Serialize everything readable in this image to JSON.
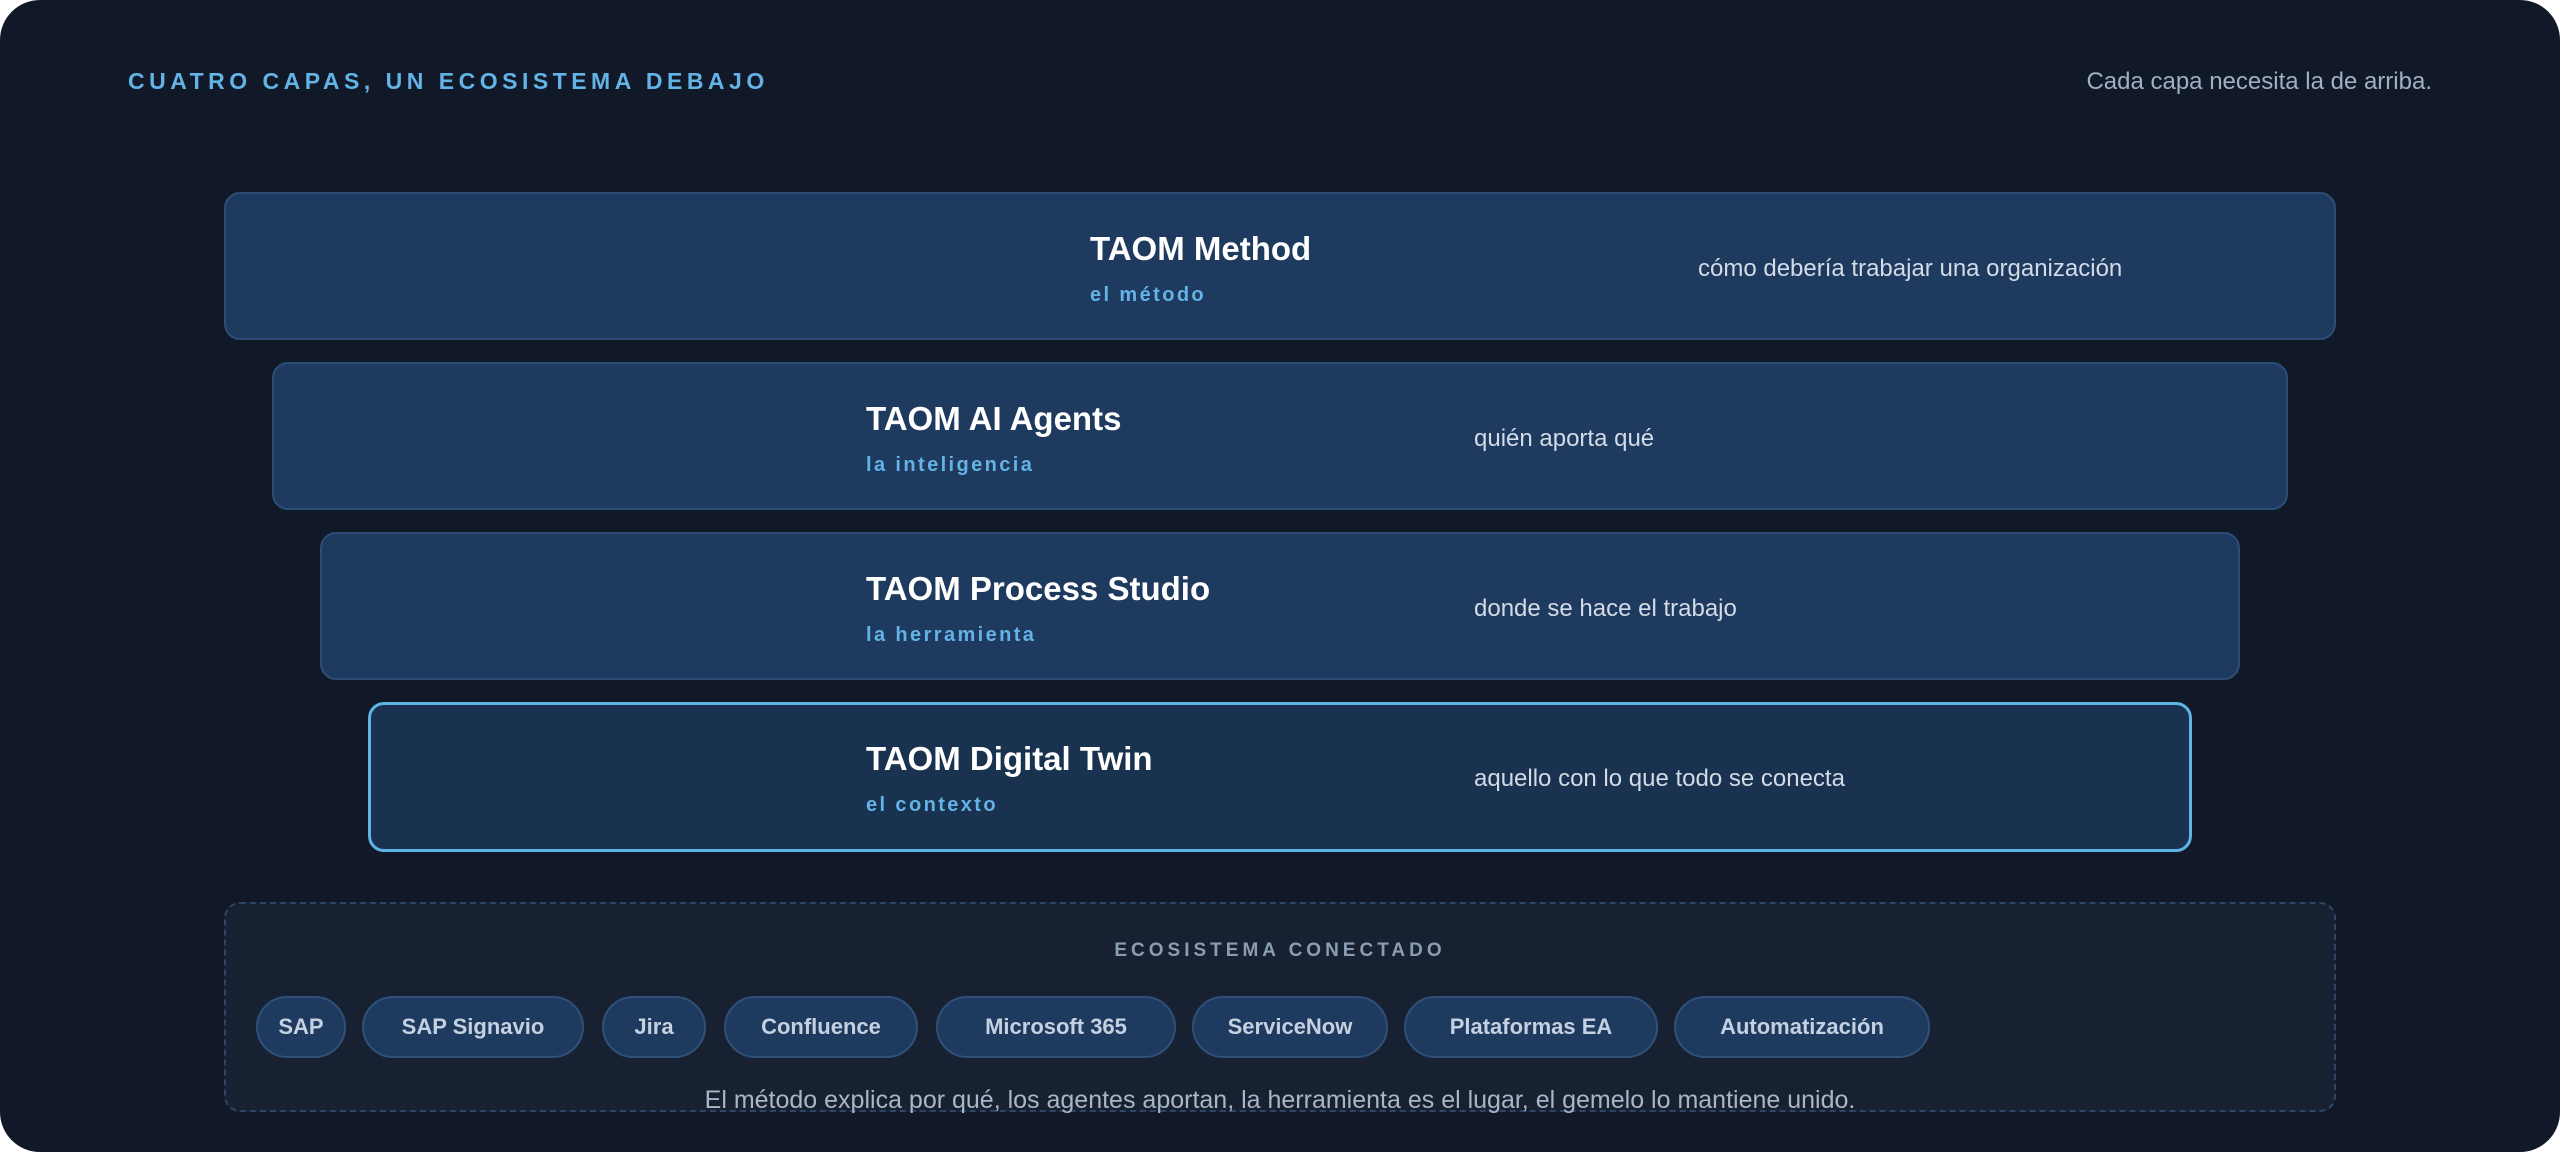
{
  "header": {
    "eyebrow": "CUATRO CAPAS, UN ECOSISTEMA DEBAJO",
    "tagline": "Cada capa necesita la de arriba."
  },
  "layers": [
    {
      "name": "TAOM Method",
      "subtitle": "el método",
      "description": "cómo debería trabajar una organización"
    },
    {
      "name": "TAOM AI Agents",
      "subtitle": "la inteligencia",
      "description": "quién aporta qué"
    },
    {
      "name": "TAOM Process Studio",
      "subtitle": "la herramienta",
      "description": "donde se hace el trabajo"
    },
    {
      "name": "TAOM Digital Twin",
      "subtitle": "el contexto",
      "description": "aquello con lo que todo se conecta"
    }
  ],
  "ecosystem": {
    "title": "ECOSISTEMA CONECTADO",
    "chips": [
      "SAP",
      "SAP Signavio",
      "Jira",
      "Confluence",
      "Microsoft 365",
      "ServiceNow",
      "Plataformas EA",
      "Automatización"
    ]
  },
  "footnote": "El método explica por qué, los agentes aportan, la herramienta es el lugar, el gemelo lo mantiene unido.",
  "colors": {
    "background": "#111827",
    "accent": "#63b3e6",
    "layer_fill": "#1f3a5f",
    "active_border": "#5fb4e6"
  }
}
